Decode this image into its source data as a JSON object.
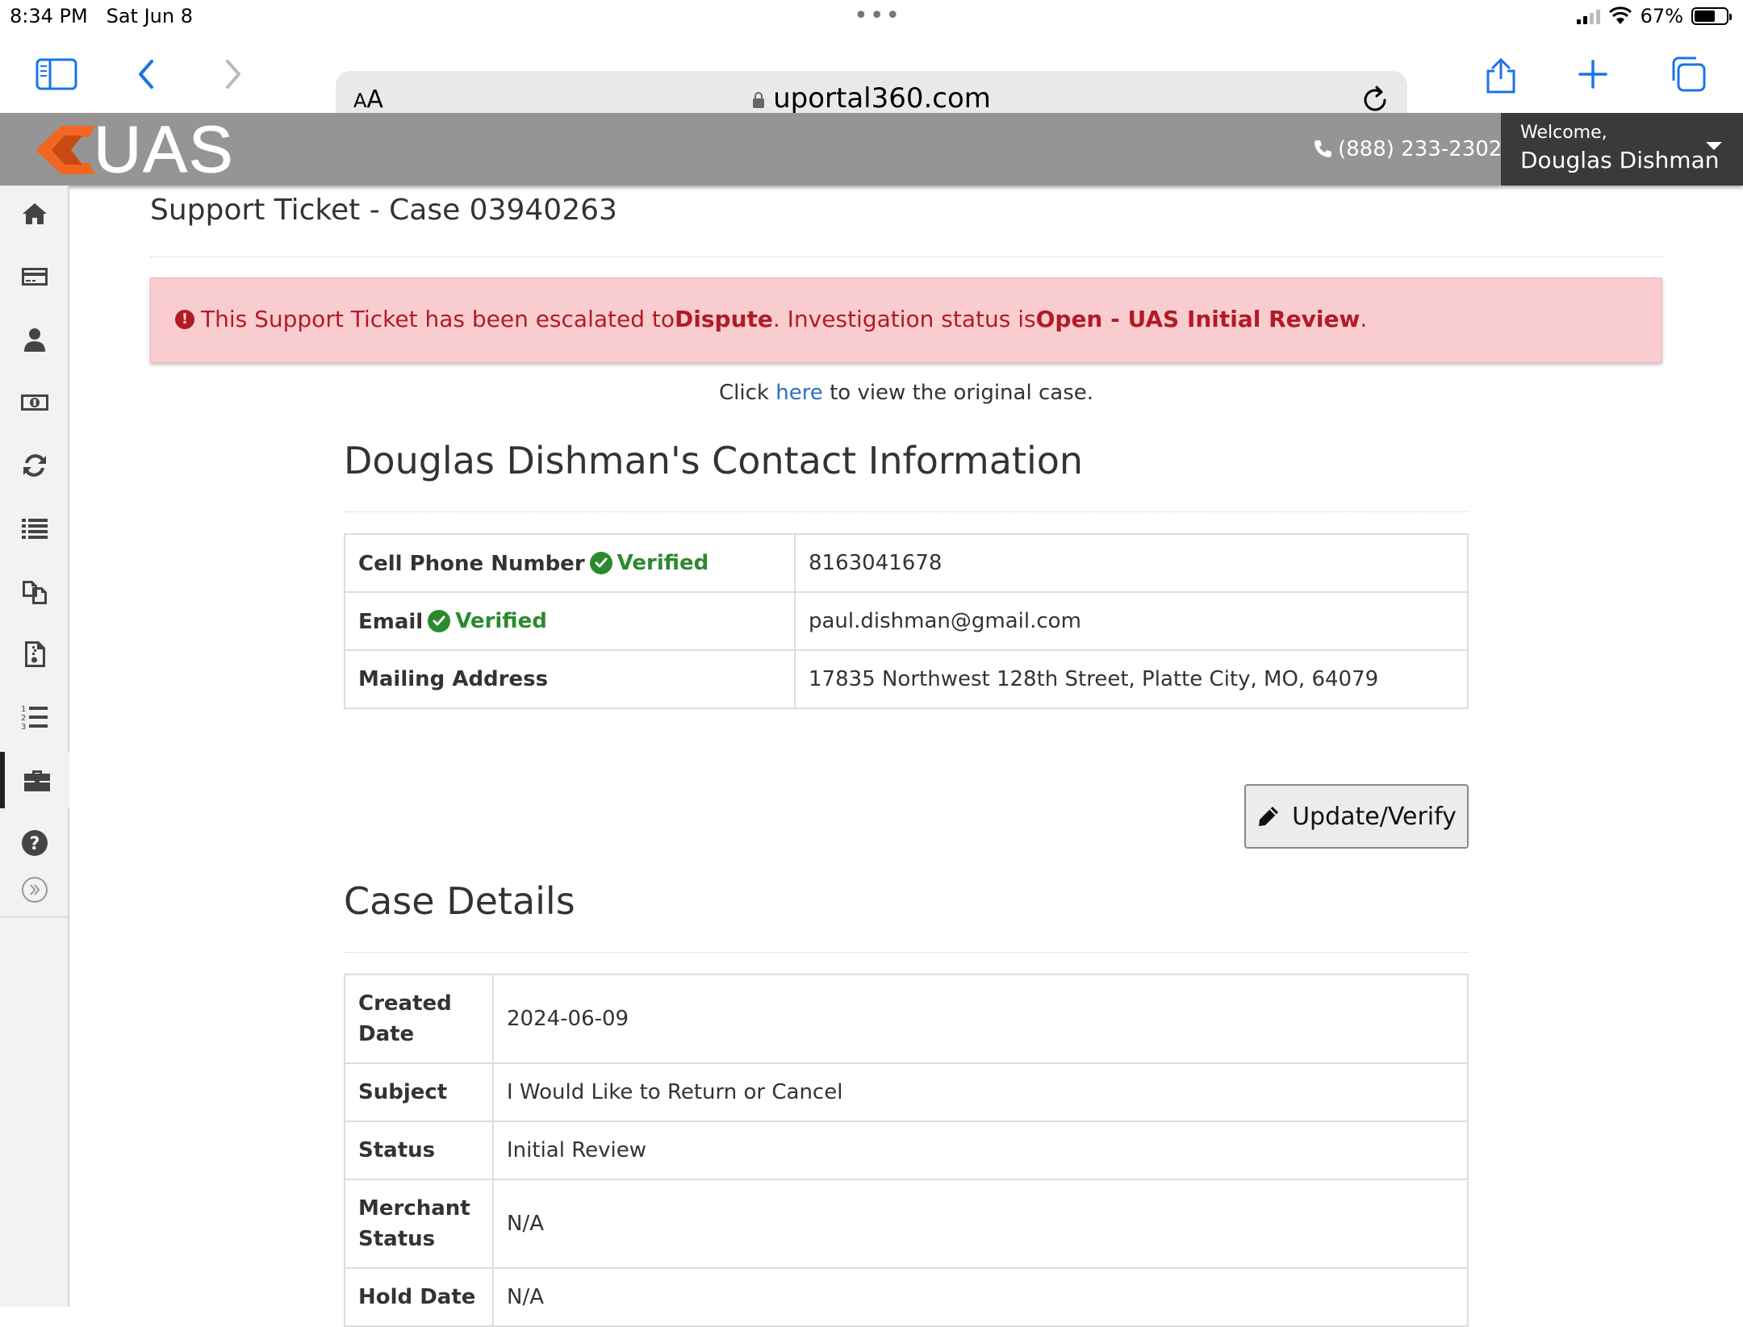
{
  "status_bar": {
    "time": "8:34 PM",
    "date": "Sat Jun 8",
    "battery": "67%",
    "battery_level": 0.67
  },
  "browser": {
    "text_size_label": "AA",
    "url": "uportal360.com"
  },
  "header": {
    "logo_text": "UAS",
    "phone": "(888) 233-2302",
    "welcome_label": "Welcome,",
    "user_name": "Douglas Dishman"
  },
  "sidebar": {
    "items": [
      {
        "icon": "home-icon"
      },
      {
        "icon": "credit-card-icon"
      },
      {
        "icon": "user-icon"
      },
      {
        "icon": "money-icon"
      },
      {
        "icon": "refresh-icon"
      },
      {
        "icon": "list-icon"
      },
      {
        "icon": "copy-icon"
      },
      {
        "icon": "document-icon"
      },
      {
        "icon": "numbered-list-icon"
      },
      {
        "icon": "briefcase-icon",
        "active": true
      },
      {
        "icon": "help-icon"
      },
      {
        "icon": "expand-icon"
      }
    ]
  },
  "page": {
    "title": "Support Ticket - Case 03940263",
    "alert": {
      "prefix": "This Support Ticket has been escalated to ",
      "dispute": "Dispute",
      "middle": ". Investigation status is ",
      "status": "Open - UAS Initial Review",
      "suffix": "."
    },
    "click_line": {
      "before": "Click ",
      "link": "here",
      "after": " to view the original case."
    }
  },
  "contact": {
    "heading": "Douglas Dishman's Contact Information",
    "verified_label": "Verified",
    "rows": [
      {
        "label": "Cell Phone Number",
        "verified": true,
        "value": "8163041678"
      },
      {
        "label": "Email",
        "verified": true,
        "value": "paul.dishman@gmail.com"
      },
      {
        "label": "Mailing Address",
        "verified": false,
        "value": "17835 Northwest 128th Street, Platte City, MO, 64079"
      }
    ],
    "update_button": "Update/Verify"
  },
  "case_details": {
    "heading": "Case Details",
    "rows": [
      {
        "label": "Created Date",
        "value": "2024-06-09"
      },
      {
        "label": "Subject",
        "value": "I Would Like to Return or Cancel"
      },
      {
        "label": "Status",
        "value": "Initial Review"
      },
      {
        "label": "Merchant Status",
        "value": "N/A"
      },
      {
        "label": "Hold Date",
        "value": "N/A"
      }
    ]
  },
  "colors": {
    "alert_bg": "#f9cdd0",
    "alert_text": "#b31a25",
    "verified": "#2b8a2f",
    "link": "#2f6fbd",
    "header_bg": "#959595",
    "brand_orange": "#f26522"
  }
}
